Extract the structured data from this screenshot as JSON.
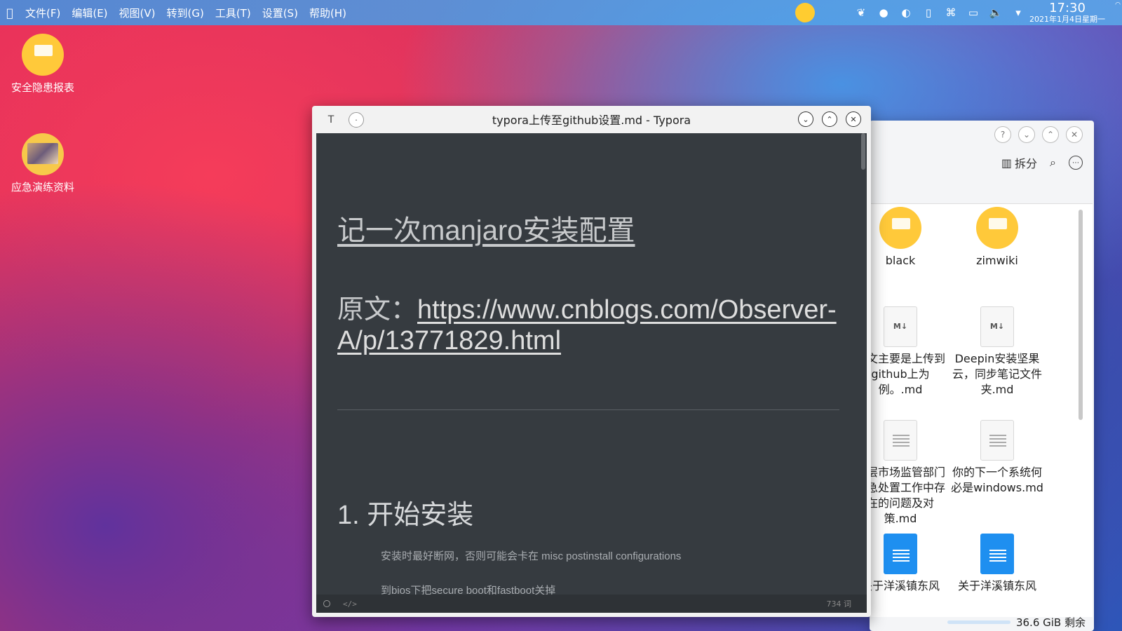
{
  "menubar": {
    "apple_icon": "apple-icon",
    "items": [
      "文件(F)",
      "编辑(E)",
      "视图(V)",
      "转到(G)",
      "工具(T)",
      "设置(S)",
      "帮助(H)"
    ],
    "clock_time": "17:30",
    "clock_date": "2021年1月4日星期一",
    "tray_icons": [
      "weather-icon",
      "plant-icon",
      "network-icon",
      "robot-icon",
      "clipboard-icon",
      "command-icon",
      "screen-icon",
      "volume-icon",
      "chevron-down-icon"
    ]
  },
  "desktop": {
    "icons": [
      {
        "label": "安全隐患报表"
      },
      {
        "label": "应急演练资料"
      }
    ]
  },
  "typora": {
    "title": "typora上传至github设置.md - Typora",
    "left_btn_1": "T",
    "left_btn_2": "·",
    "heading1": "记一次manjaro安装配置",
    "orig_label": "原文：",
    "orig_link": "https://www.cnblogs.com/Observer-A/p/13771829.html",
    "heading2": "1. 开始安装",
    "para1": "安装时最好断网，否则可能会卡在 misc postinstall configurations",
    "para2": "到bios下把secure boot和fastboot关掉",
    "footer_code": "</>",
    "word_count": "734 词"
  },
  "file_manager": {
    "toolbar_split": "拆分",
    "items": [
      {
        "label": "black"
      },
      {
        "label": "zimwiki"
      },
      {
        "label": "本文主要是上传到github上为例。.md"
      },
      {
        "label": "Deepin安装坚果云，同步笔记文件夹.md"
      },
      {
        "label": "基层市场监管部门应急处置工作中存在的问题及对策.md"
      },
      {
        "label": "你的下一个系统何必是windows.md"
      },
      {
        "label": "关于洋溪镇东风"
      },
      {
        "label": "关于洋溪镇东风"
      }
    ],
    "markdown_badge": "M↓",
    "free_space": "36.6 GiB 剩余"
  }
}
